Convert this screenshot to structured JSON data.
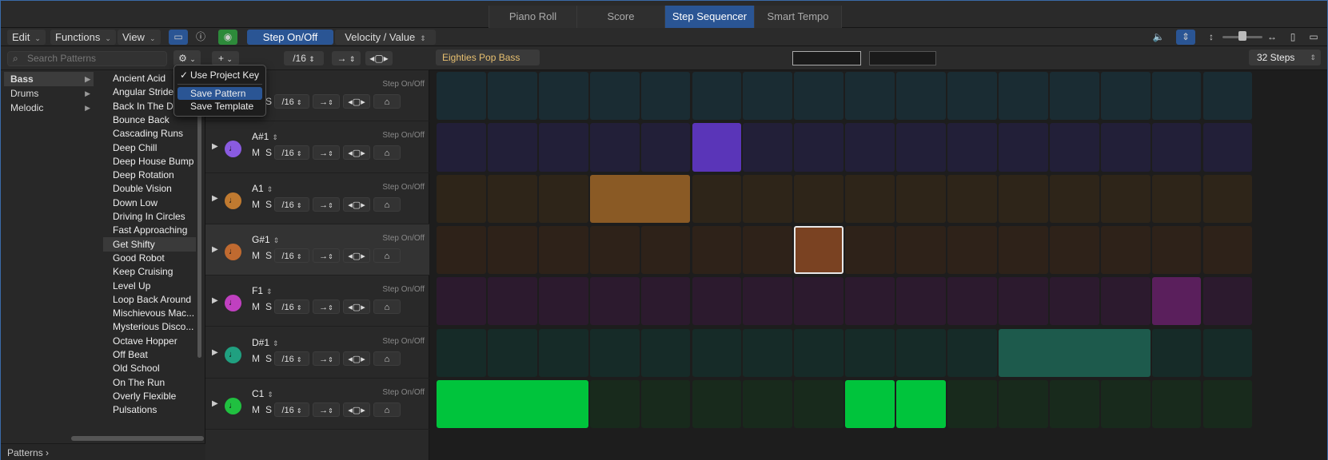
{
  "tabs": [
    {
      "label": "Piano Roll",
      "active": false
    },
    {
      "label": "Score",
      "active": false
    },
    {
      "label": "Step Sequencer",
      "active": true
    },
    {
      "label": "Smart Tempo",
      "active": false
    }
  ],
  "toolbar": {
    "edit": "Edit",
    "functions": "Functions",
    "view": "View",
    "mode_step": "Step On/Off",
    "mode_velocity": "Velocity / Value"
  },
  "browser": {
    "search_placeholder": "Search Patterns",
    "categories": [
      "Bass",
      "Drums",
      "Melodic"
    ],
    "selected_category": "Bass",
    "patterns": [
      "Ancient Acid",
      "Angular Stride",
      "Back In The Day",
      "Bounce Back",
      "Cascading Runs",
      "Deep Chill",
      "Deep House Bump",
      "Deep Rotation",
      "Double Vision",
      "Down Low",
      "Driving In Circles",
      "Fast Approaching",
      "Get Shifty",
      "Good Robot",
      "Keep Cruising",
      "Level Up",
      "Loop Back Around",
      "Mischievous Mac...",
      "Mysterious Disco...",
      "Octave Hopper",
      "Off Beat",
      "Old School",
      "On The Run",
      "Overly Flexible",
      "Pulsations"
    ],
    "selected_pattern": "Get Shifty",
    "footer": "Patterns"
  },
  "menu": {
    "items": [
      {
        "label": "Use Project Key",
        "checked": true
      },
      {
        "label": "Save Pattern",
        "highlighted": true
      },
      {
        "label": "Save Template"
      }
    ]
  },
  "rowhead": {
    "add": "+",
    "rate": "/16"
  },
  "rows": [
    {
      "name": "",
      "label": "Step On/Off",
      "mute": "M",
      "solo": "S",
      "rate": "/16",
      "color": "#3a7a8a",
      "cellbg": "#1a2c33",
      "active": []
    },
    {
      "name": "A#1",
      "label": "Step On/Off",
      "mute": "M",
      "solo": "S",
      "rate": "/16",
      "color": "#8a5be0",
      "cellbg": "#221f38",
      "active": [
        [
          5,
          1
        ]
      ],
      "on": "#5a35b8"
    },
    {
      "name": "A1",
      "label": "Step On/Off",
      "mute": "M",
      "solo": "S",
      "rate": "/16",
      "color": "#c07a30",
      "cellbg": "#2e2519",
      "active": [
        [
          3,
          2
        ]
      ],
      "on": "#8a5a25"
    },
    {
      "name": "G#1",
      "label": "Step On/Off",
      "mute": "M",
      "solo": "S",
      "rate": "/16",
      "color": "#c06a30",
      "cellbg": "#2e2219",
      "active": [
        [
          7,
          1
        ]
      ],
      "on": "#7a4222",
      "selected": true
    },
    {
      "name": "F1",
      "label": "Step On/Off",
      "mute": "M",
      "solo": "S",
      "rate": "/16",
      "color": "#c040c0",
      "cellbg": "#2c1a2e",
      "active": [
        [
          14,
          1
        ]
      ],
      "on": "#5a1f5c"
    },
    {
      "name": "D#1",
      "label": "Step On/Off",
      "mute": "M",
      "solo": "S",
      "rate": "/16",
      "color": "#20a080",
      "cellbg": "#162b28",
      "active": [
        [
          11,
          3
        ]
      ],
      "on": "#1d5a4c"
    },
    {
      "name": "C1",
      "label": "Step On/Off",
      "mute": "M",
      "solo": "S",
      "rate": "/16",
      "color": "#20c040",
      "cellbg": "#182a1c",
      "active": [
        [
          0,
          3
        ],
        [
          8,
          1
        ],
        [
          9,
          1
        ]
      ],
      "on": "#00c43c"
    }
  ],
  "grid": {
    "pattern_name": "Eighties Pop Bass",
    "steps_label": "32 Steps",
    "columns": 16
  }
}
